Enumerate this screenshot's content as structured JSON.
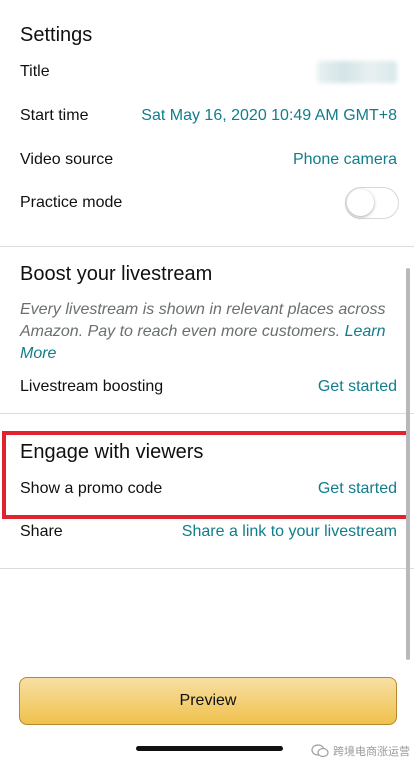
{
  "settings": {
    "title": "Settings",
    "rows": {
      "title_label": "Title",
      "start_time_label": "Start time",
      "start_time_value": "Sat May 16, 2020 10:49 AM GMT+8",
      "video_source_label": "Video source",
      "video_source_value": "Phone camera",
      "practice_mode_label": "Practice mode",
      "practice_mode_on": false
    }
  },
  "boost": {
    "title": "Boost your livestream",
    "description": "Every livestream is shown in relevant places across Amazon. Pay to reach even more customers. ",
    "learn_more": "Learn More",
    "row_label": "Livestream boosting",
    "row_action": "Get started"
  },
  "engage": {
    "title": "Engage with viewers",
    "promo_label": "Show a promo code",
    "promo_action": "Get started",
    "share_label": "Share",
    "share_action": "Share a link to your livestream"
  },
  "footer": {
    "preview_label": "Preview",
    "watermark": "跨境电商涨运营"
  },
  "colors": {
    "link": "#117d8b",
    "highlight": "#e0242f",
    "button": "#f0c14b"
  }
}
